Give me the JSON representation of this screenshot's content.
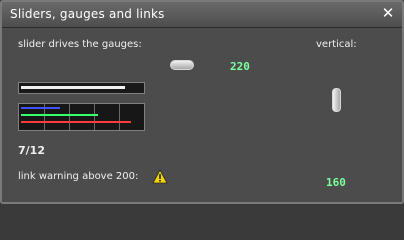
{
  "window": {
    "title": "Sliders, gauges and links",
    "close_icon": "close-icon"
  },
  "labels": {
    "slider_text": "slider drives the gauges:",
    "vertical_text": "vertical:",
    "page_counter": "7/12",
    "warning_text": "link warning above 200:"
  },
  "values": {
    "horizontal_value": "220",
    "vertical_value": "160"
  },
  "gauges": {
    "white_level": 0.86,
    "bars": [
      {
        "color": "#3f52ff",
        "fraction": 0.32
      },
      {
        "color": "#35ff6a",
        "fraction": 0.64
      },
      {
        "color": "#ff3a3a",
        "fraction": 0.91
      }
    ]
  },
  "icons": {
    "warning": "warning-icon"
  },
  "colors": {
    "window_bg": "#4a4a4a",
    "value_green": "#7dff9a"
  }
}
